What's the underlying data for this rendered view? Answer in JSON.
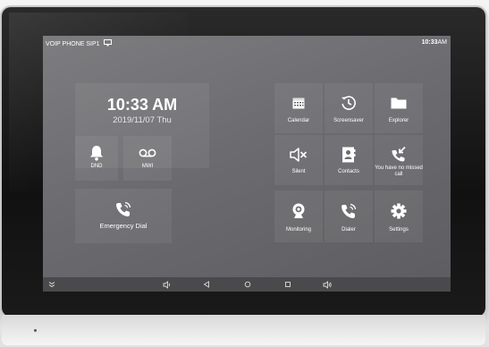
{
  "status": {
    "left_title": "VOIP PHONE SIP1",
    "time_bold": "10:33",
    "time_suffix": "AM"
  },
  "clock": {
    "time": "10:33 AM",
    "date": "2019/11/07 Thu"
  },
  "left_tiles": {
    "dnd": "DND",
    "mwi": "MWI",
    "emergency": "Emergency Dial"
  },
  "apps": {
    "calendar": "Calendar",
    "screensaver": "Screensaver",
    "explorer": "Explorer",
    "silent": "Silent",
    "contacts": "Contacts",
    "missed_call": "You have no missed call",
    "monitoring": "Monitoring",
    "dialer": "Dialer",
    "settings": "Settings"
  },
  "colors": {
    "screen": "#6c6c70",
    "navbar": "#4a4a4d",
    "text": "#ffffff"
  }
}
